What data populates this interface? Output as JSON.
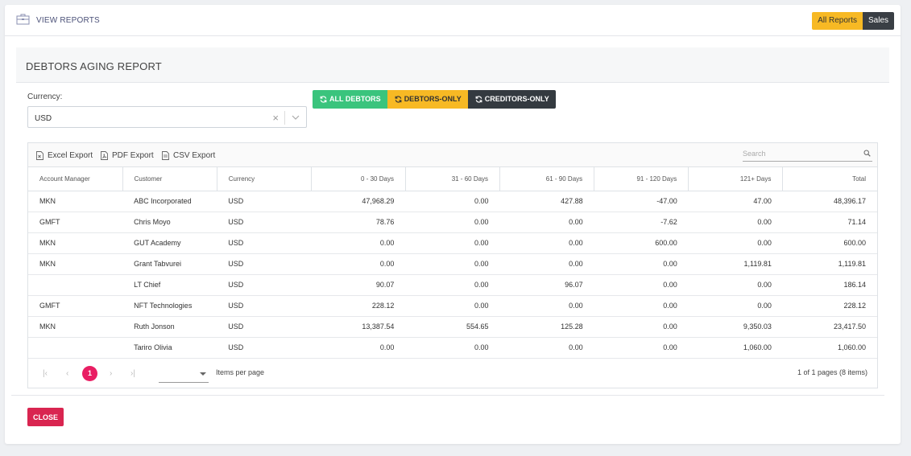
{
  "header": {
    "title": "VIEW REPORTS",
    "tabs": [
      "All Reports",
      "Sales"
    ]
  },
  "report": {
    "title": "DEBTORS AGING REPORT"
  },
  "currency": {
    "label": "Currency:",
    "value": "USD"
  },
  "filters": {
    "all_debtors": "ALL DEBTORS",
    "debtors_only": "DEBTORS-ONLY",
    "creditors_only": "CREDITORS-ONLY"
  },
  "toolbar": {
    "excel": "Excel Export",
    "pdf": "PDF Export",
    "csv": "CSV Export",
    "search_placeholder": "Search"
  },
  "table": {
    "columns": [
      "Account Manager",
      "Customer",
      "Currency",
      "0 - 30 Days",
      "31 - 60 Days",
      "61 - 90 Days",
      "91 - 120 Days",
      "121+ Days",
      "Total"
    ],
    "rows": [
      [
        "MKN",
        "ABC Incorporated",
        "USD",
        "47,968.29",
        "0.00",
        "427.88",
        "-47.00",
        "47.00",
        "48,396.17"
      ],
      [
        "GMFT",
        "Chris Moyo",
        "USD",
        "78.76",
        "0.00",
        "0.00",
        "-7.62",
        "0.00",
        "71.14"
      ],
      [
        "MKN",
        "GUT Academy",
        "USD",
        "0.00",
        "0.00",
        "0.00",
        "600.00",
        "0.00",
        "600.00"
      ],
      [
        "MKN",
        "Grant Tabvurei",
        "USD",
        "0.00",
        "0.00",
        "0.00",
        "0.00",
        "1,119.81",
        "1,119.81"
      ],
      [
        "",
        "LT Chief",
        "USD",
        "90.07",
        "0.00",
        "96.07",
        "0.00",
        "0.00",
        "186.14"
      ],
      [
        "GMFT",
        "NFT Technologies",
        "USD",
        "228.12",
        "0.00",
        "0.00",
        "0.00",
        "0.00",
        "228.12"
      ],
      [
        "MKN",
        "Ruth Jonson",
        "USD",
        "13,387.54",
        "554.65",
        "125.28",
        "0.00",
        "9,350.03",
        "23,417.50"
      ],
      [
        "",
        "Tariro Olivia",
        "USD",
        "0.00",
        "0.00",
        "0.00",
        "0.00",
        "1,060.00",
        "1,060.00"
      ]
    ]
  },
  "pager": {
    "current_page": "1",
    "items_per_page_label": "Items per page",
    "info": "1 of 1 pages (8 items)"
  },
  "footer": {
    "close": "CLOSE"
  },
  "colors": {
    "green": "#3ac47d",
    "yellow": "#f7b924",
    "dark": "#343a40",
    "red": "#d92550",
    "pink": "#e91e63"
  }
}
